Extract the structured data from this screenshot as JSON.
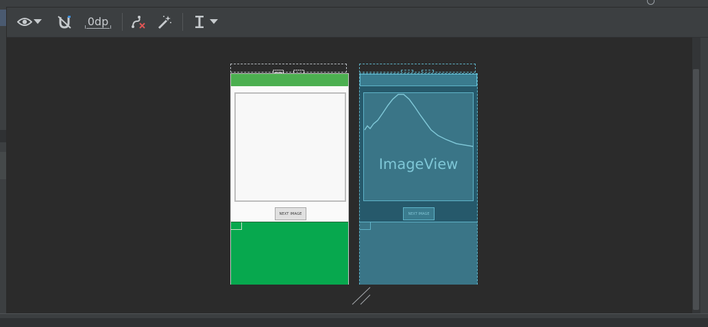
{
  "toolbar": {
    "margin_value": "0dp",
    "items": [
      {
        "name": "eye-icon"
      },
      {
        "name": "dropdown-arrow-icon"
      },
      {
        "name": "magnet-off-icon"
      },
      {
        "name": "clear-constraints-icon"
      },
      {
        "name": "magic-wand-icon"
      },
      {
        "name": "align-icon"
      }
    ]
  },
  "design": {
    "button_label": "NEXT IMAGE"
  },
  "blueprint": {
    "image_view_label": "ImageView",
    "button_label": "NEXT IMAGE"
  },
  "colors": {
    "appbar_green": "#4caf50",
    "frame_green": "#07a84e",
    "blueprint_bg": "#26596b",
    "blueprint_line": "#5fb4c9",
    "clear_constraints_red": "#e05555",
    "magnet_accent": "#3d8fdb"
  }
}
